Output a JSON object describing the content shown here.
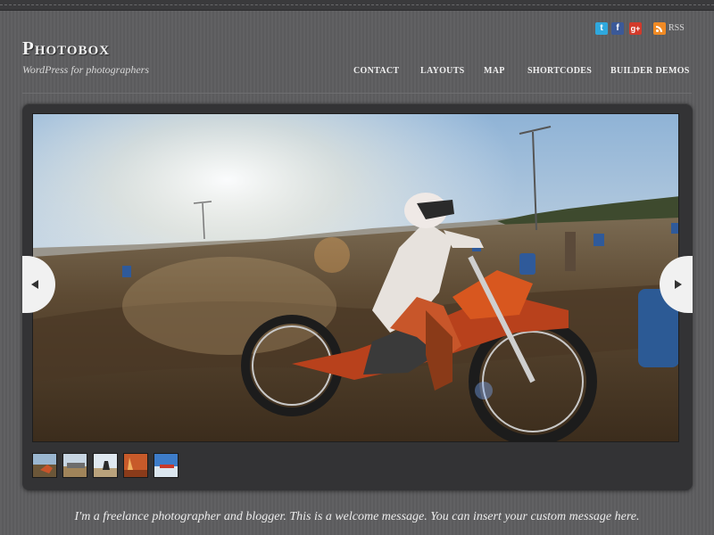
{
  "header": {
    "logo": "Photobox",
    "tagline": "WordPress for photographers"
  },
  "social": {
    "icons": [
      "twitter-icon",
      "facebook-icon",
      "google-plus-icon",
      "rss-icon"
    ],
    "rss_label": "RSS"
  },
  "nav": {
    "items": [
      "CONTACT",
      "LAYOUTS",
      "MAP",
      "SHORTCODES",
      "BUILDER DEMOS"
    ]
  },
  "slider": {
    "thumbnail_count": 5,
    "prev_icon": "chevron-left-icon",
    "next_icon": "chevron-right-icon"
  },
  "welcome": "I'm a freelance photographer and blogger. This is a welcome message. You can insert your custom message here.",
  "colors": {
    "background": "#5d5d5f",
    "slider_frame": "#333335",
    "arrow_bg": "#f1f1f1",
    "text": "#f0f0f0"
  }
}
